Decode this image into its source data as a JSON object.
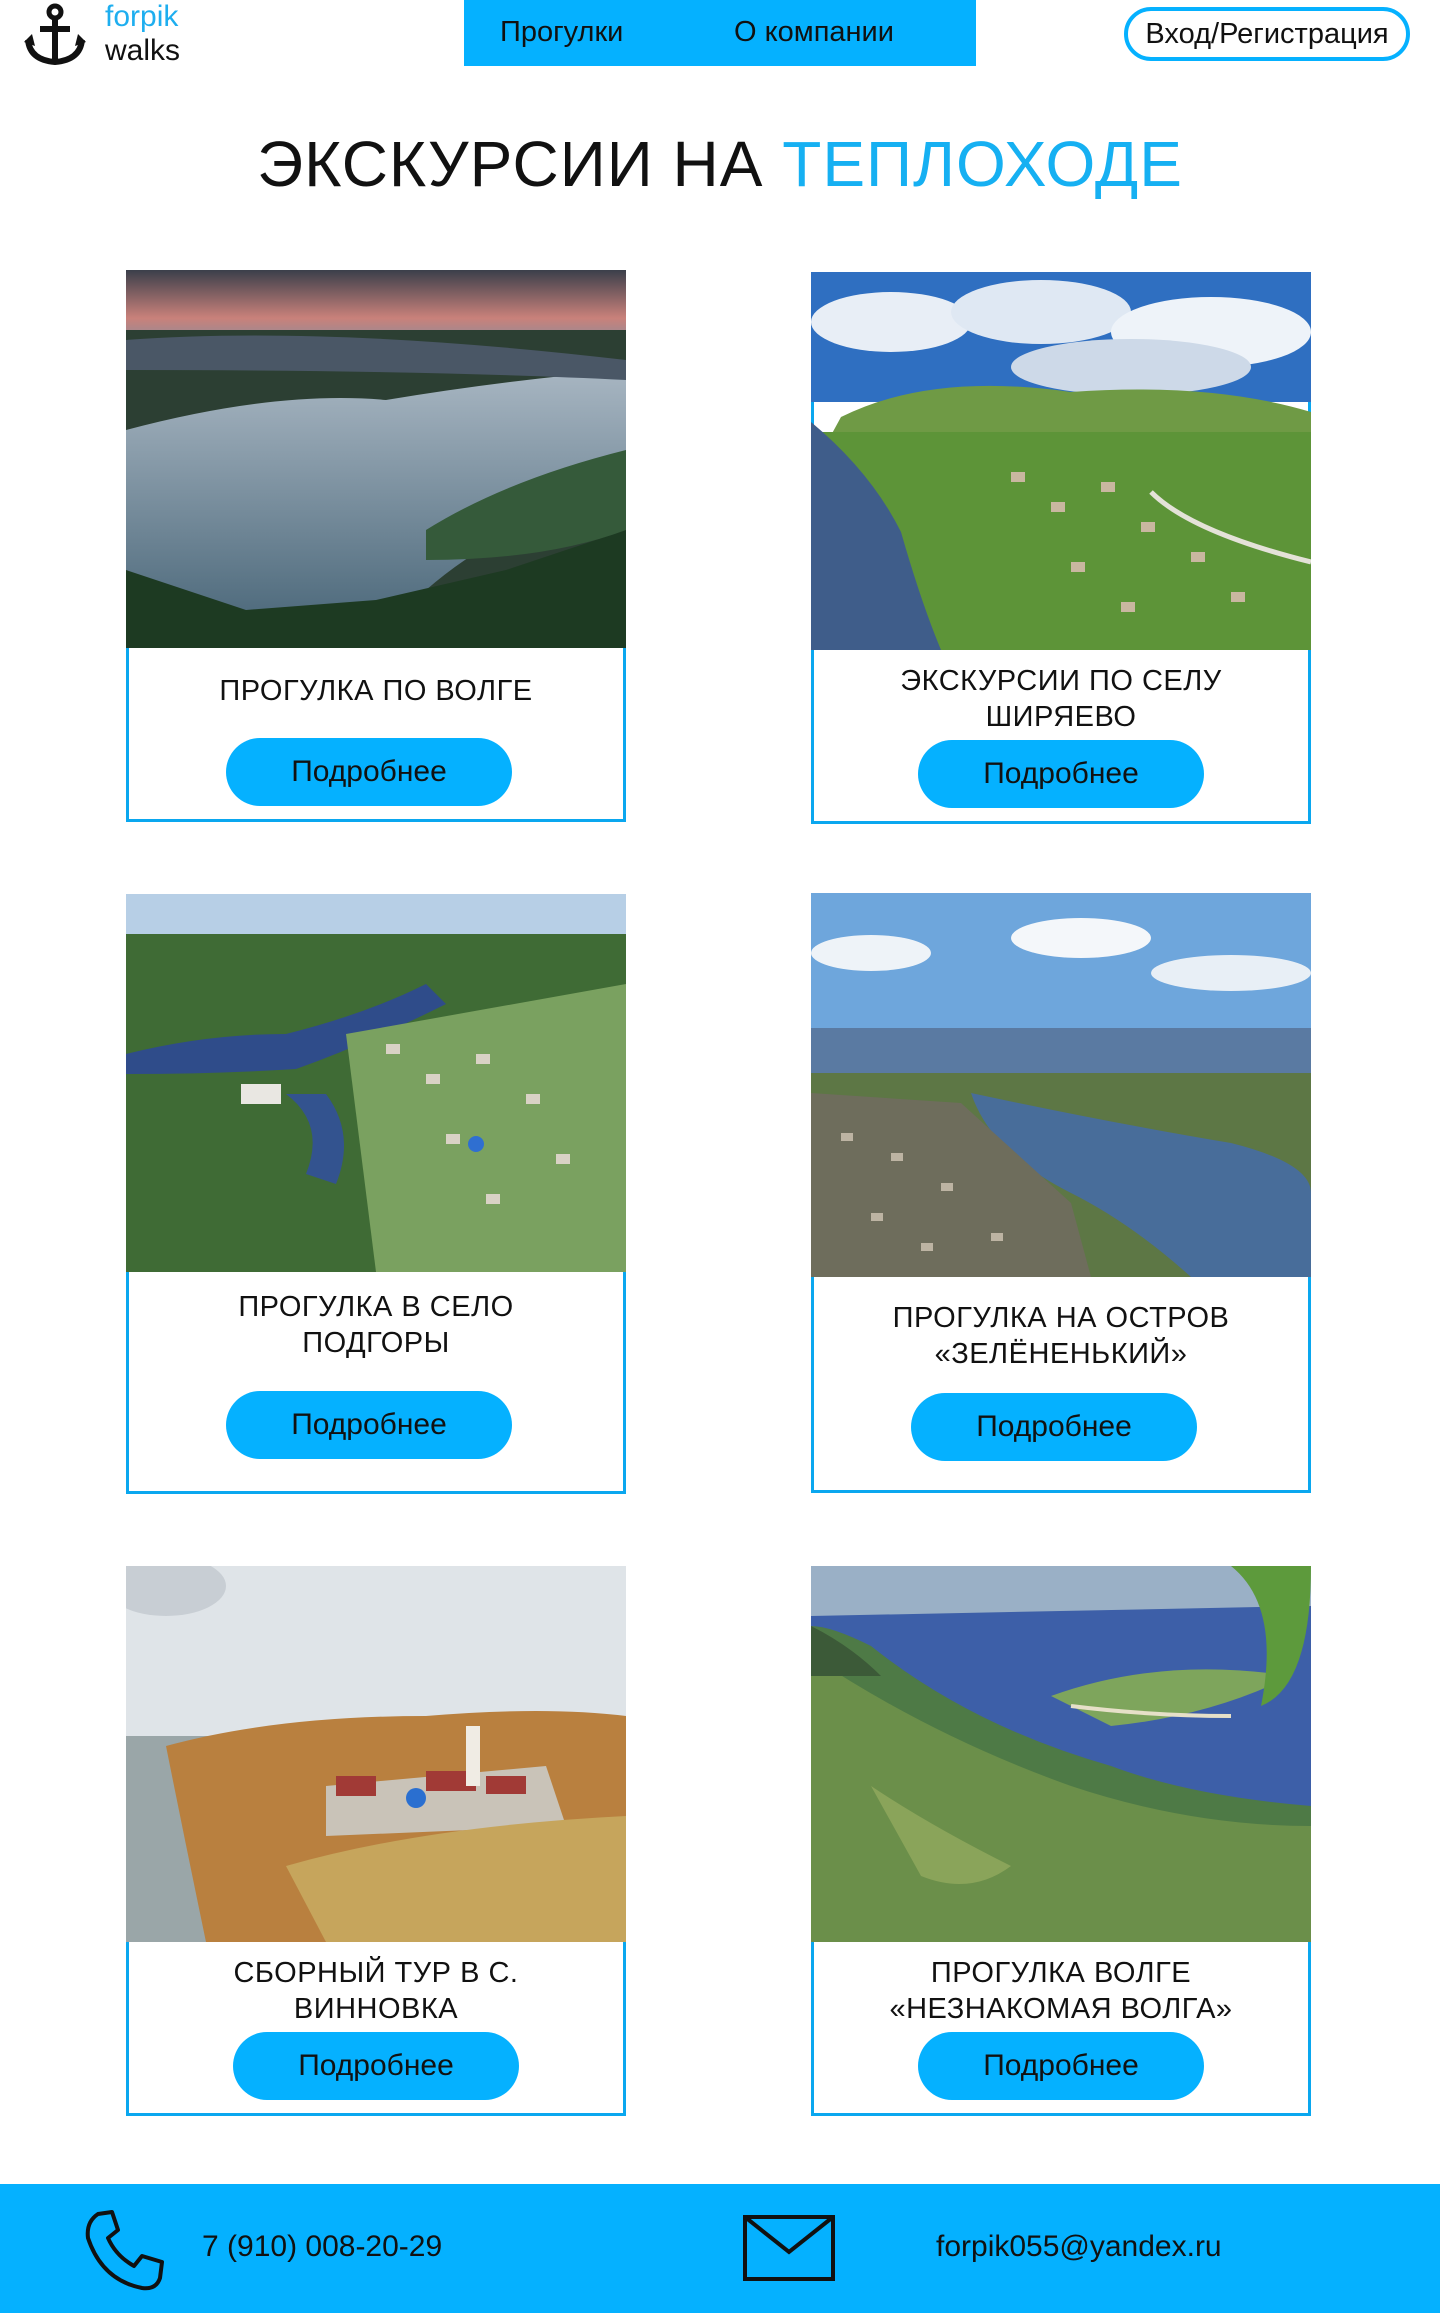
{
  "header": {
    "logo_top": "forpik",
    "logo_bottom": "walks",
    "nav": [
      "Прогулки",
      "О компании"
    ],
    "login_label": "Вход/Регистрация"
  },
  "page": {
    "title_main": "ЭКСКУРСИИ НА ",
    "title_accent": "ТЕПЛОХОДЕ"
  },
  "cards": [
    {
      "title": "ПРОГУЛКА ПО ВОЛГЕ",
      "button": "Подробнее"
    },
    {
      "title": "ЭКСКУРСИИ ПО СЕЛУ ШИРЯЕВО",
      "button": "Подробнее"
    },
    {
      "title": "ПРОГУЛКА В СЕЛО ПОДГОРЫ",
      "button": "Подробнее"
    },
    {
      "title": "ПРОГУЛКА НА ОСТРОВ «ЗЕЛЁНЕНЬКИЙ»",
      "button": "Подробнее"
    },
    {
      "title": "СБОРНЫЙ ТУР В С. ВИННОВКА",
      "button": "Подробнее"
    },
    {
      "title": "ПРОГУЛКА ВОЛГЕ «НЕЗНАКОМАЯ ВОЛГА»",
      "button": "Подробнее"
    }
  ],
  "footer": {
    "phone": "7 (910) 008-20-29",
    "email": "forpik055@yandex.ru"
  },
  "colors": {
    "accent": "#05b1ff",
    "border": "#0aa7ef",
    "text": "#111111"
  }
}
